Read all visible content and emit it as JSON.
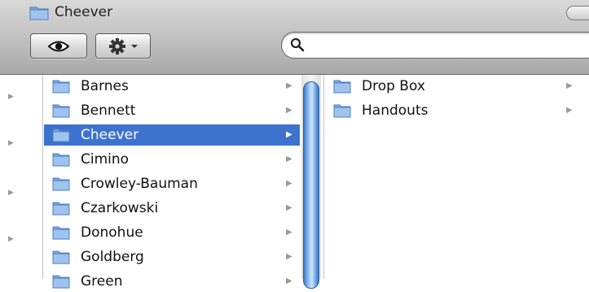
{
  "window": {
    "title": "Cheever",
    "title_icon": "folder-icon"
  },
  "toolbar": {
    "quicklook_icon": "eye-icon",
    "action_icon": "gear-icon",
    "action_menu_icon": "chevron-down-icon"
  },
  "search": {
    "icon": "search-icon",
    "value": ""
  },
  "columns": {
    "column1": [
      {
        "label": "Barnes",
        "selected": false
      },
      {
        "label": "Bennett",
        "selected": false
      },
      {
        "label": "Cheever",
        "selected": true
      },
      {
        "label": "Cimino",
        "selected": false
      },
      {
        "label": "Crowley-Bauman",
        "selected": false
      },
      {
        "label": "Czarkowski",
        "selected": false
      },
      {
        "label": "Donohue",
        "selected": false
      },
      {
        "label": "Goldberg",
        "selected": false
      },
      {
        "label": "Green",
        "selected": false
      }
    ],
    "column2": [
      {
        "label": "Drop Box"
      },
      {
        "label": "Handouts"
      }
    ]
  },
  "colors": {
    "selection": "#3d72cf",
    "folder_blue": "#8fb6e6"
  }
}
